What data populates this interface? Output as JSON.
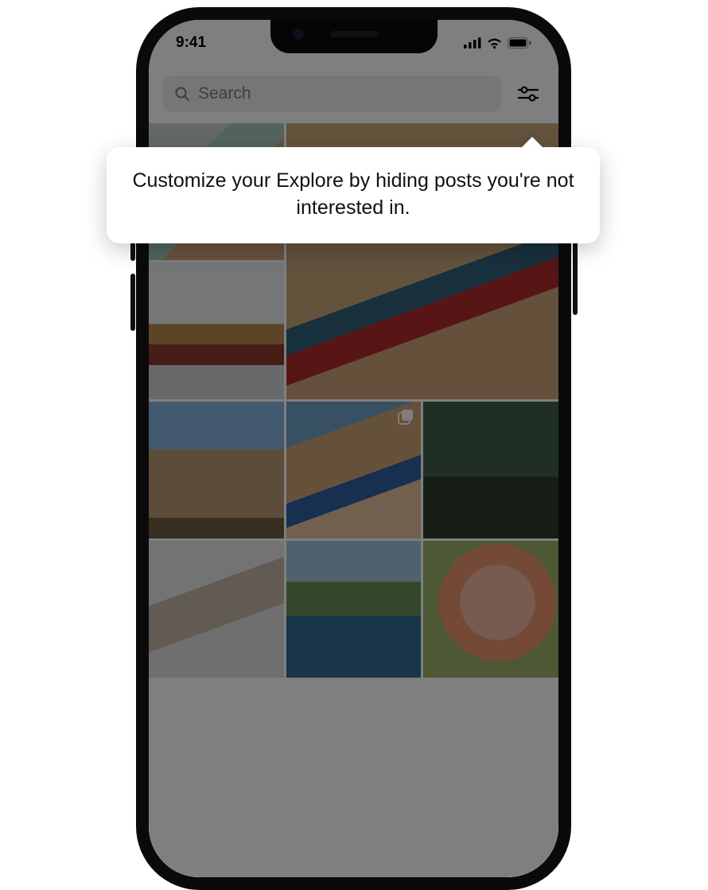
{
  "statusbar": {
    "time": "9:41"
  },
  "search": {
    "placeholder": "Search"
  },
  "tooltip": {
    "text": "Customize your Explore by hiding posts you're not interested in."
  },
  "icons": {
    "search": "search-icon",
    "filter": "sliders-icon",
    "signal": "cellular-signal-icon",
    "wifi": "wifi-icon",
    "battery": "battery-icon",
    "carousel": "carousel-icon"
  },
  "grid": {
    "tiles": [
      {
        "name": "photo-hand",
        "kind": "photo",
        "big": false
      },
      {
        "name": "photo-jump",
        "kind": "photo",
        "big": true
      },
      {
        "name": "photo-group",
        "kind": "photo",
        "big": false
      },
      {
        "name": "photo-arch",
        "kind": "photo",
        "big": false
      },
      {
        "name": "photo-beach",
        "kind": "carousel",
        "big": false
      },
      {
        "name": "photo-dining",
        "kind": "photo",
        "big": false
      },
      {
        "name": "photo-elder",
        "kind": "photo",
        "big": false
      },
      {
        "name": "photo-coast",
        "kind": "photo",
        "big": false
      },
      {
        "name": "photo-flower",
        "kind": "photo",
        "big": false
      }
    ]
  }
}
